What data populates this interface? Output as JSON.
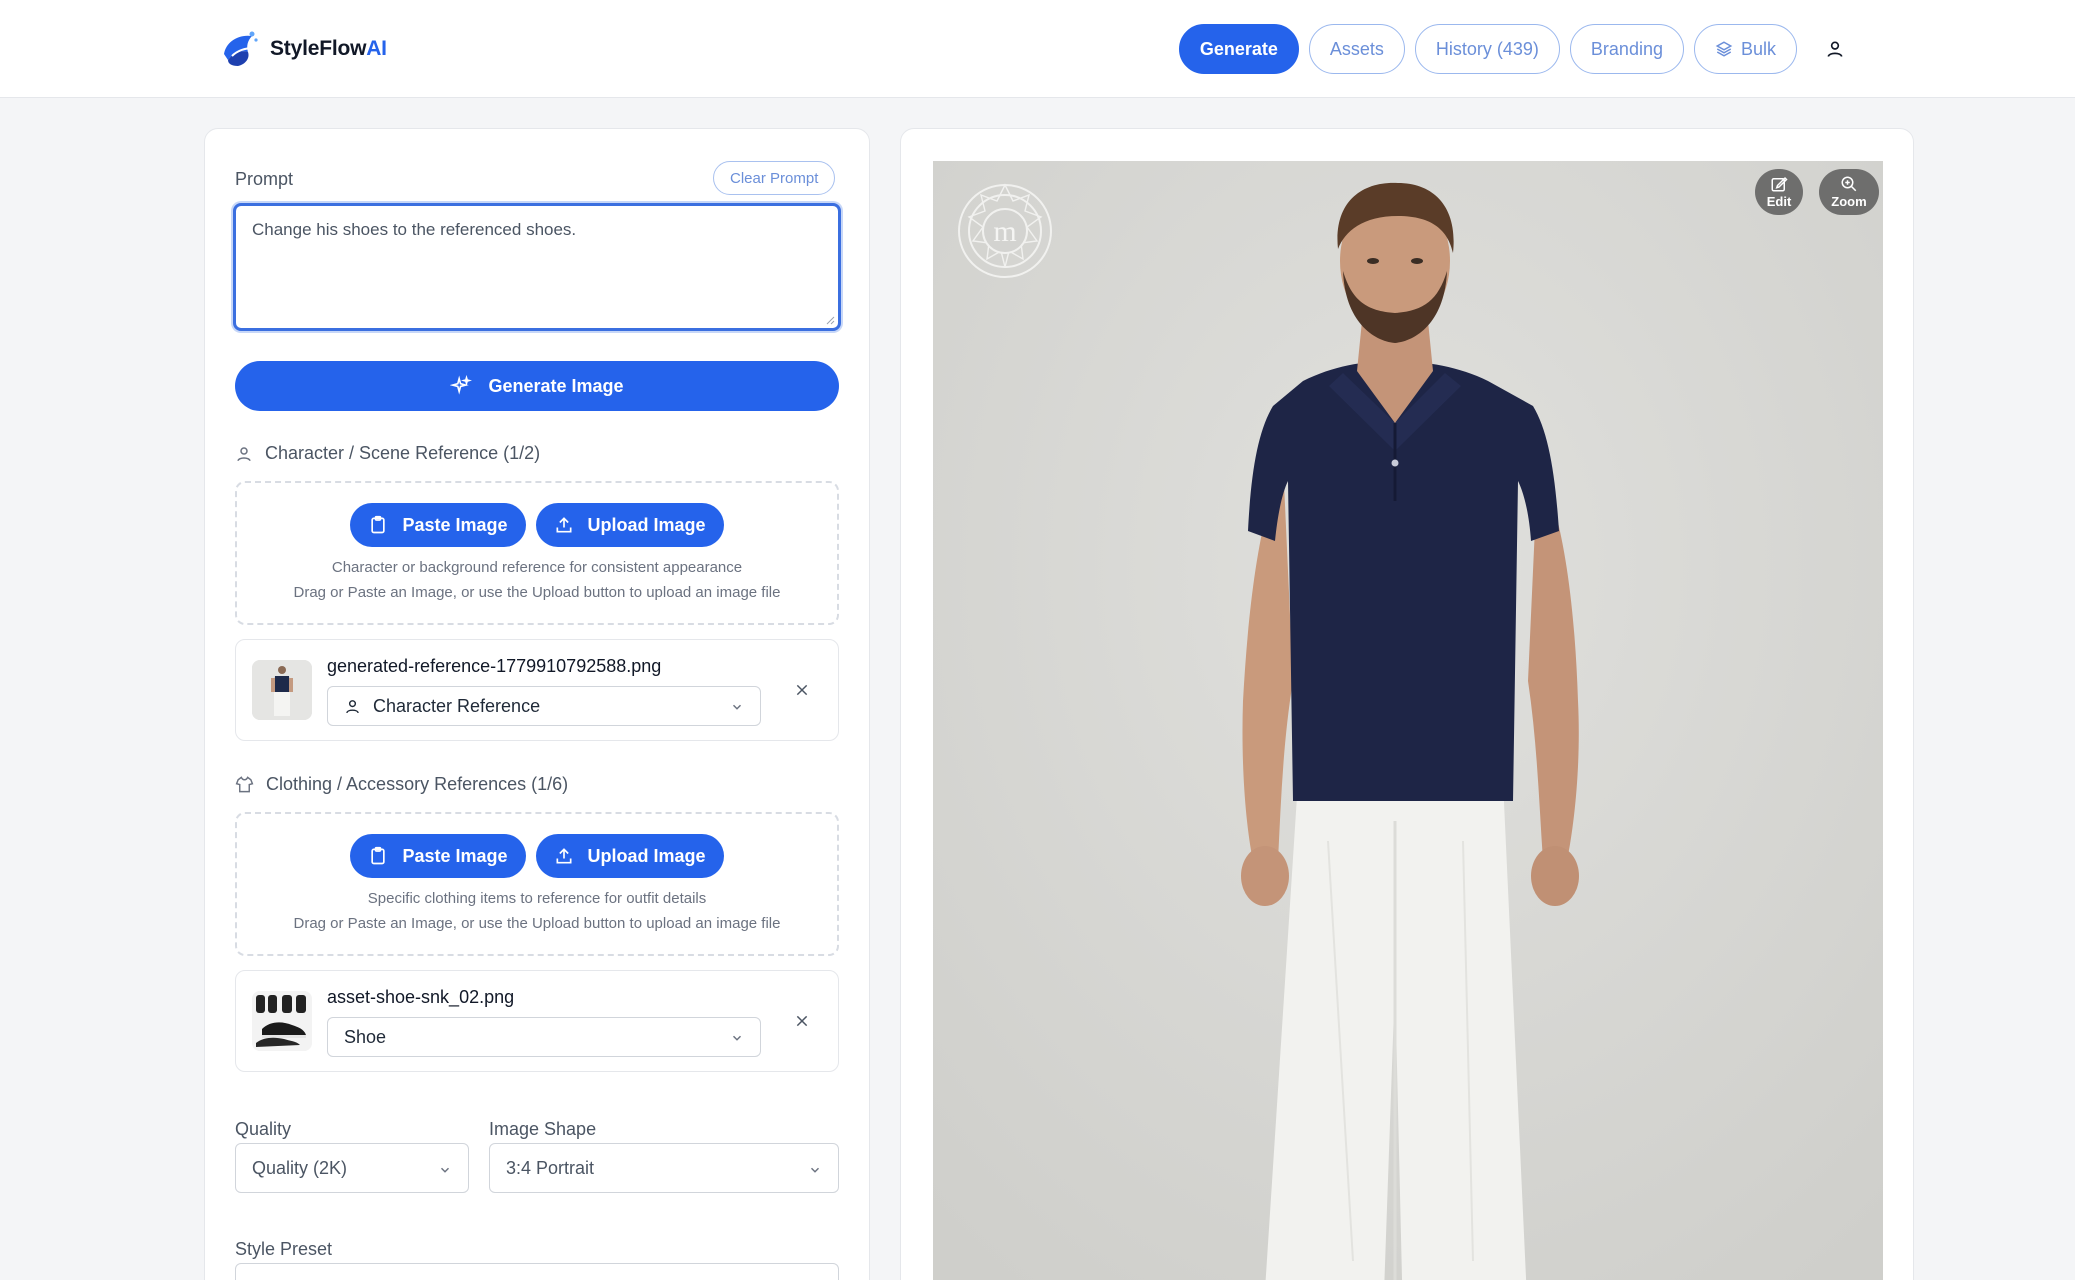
{
  "app": {
    "brand_main": "StyleFlow",
    "brand_accent": "AI",
    "accent_color": "#2563eb"
  },
  "nav": {
    "generate": "Generate",
    "assets": "Assets",
    "history": "History (439)",
    "branding": "Branding",
    "bulk": "Bulk"
  },
  "prompt": {
    "label": "Prompt",
    "clear_label": "Clear Prompt",
    "value": "Change his shoes to the referenced shoes."
  },
  "generate_button": "Generate Image",
  "character_section": {
    "title": "Character / Scene Reference (1/2)",
    "paste_label": "Paste Image",
    "upload_label": "Upload Image",
    "hint_line1": "Character or background reference for consistent appearance",
    "hint_line2": "Drag or Paste an Image, or use the Upload button to upload an image file",
    "reference": {
      "filename": "generated-reference-1779910792588.png",
      "type": "Character Reference"
    }
  },
  "clothing_section": {
    "title": "Clothing / Accessory References (1/6)",
    "paste_label": "Paste Image",
    "upload_label": "Upload Image",
    "hint_line1": "Specific clothing items to reference for outfit details",
    "hint_line2": "Drag or Paste an Image, or use the Upload button to upload an image file",
    "reference": {
      "filename": "asset-shoe-snk_02.png",
      "type": "Shoe"
    }
  },
  "settings": {
    "quality_label": "Quality",
    "quality_value": "Quality (2K)",
    "shape_label": "Image Shape",
    "shape_value": "3:4 Portrait",
    "style_label": "Style Preset"
  },
  "preview": {
    "edit_label": "Edit",
    "zoom_label": "Zoom",
    "watermark_letter": "m"
  }
}
